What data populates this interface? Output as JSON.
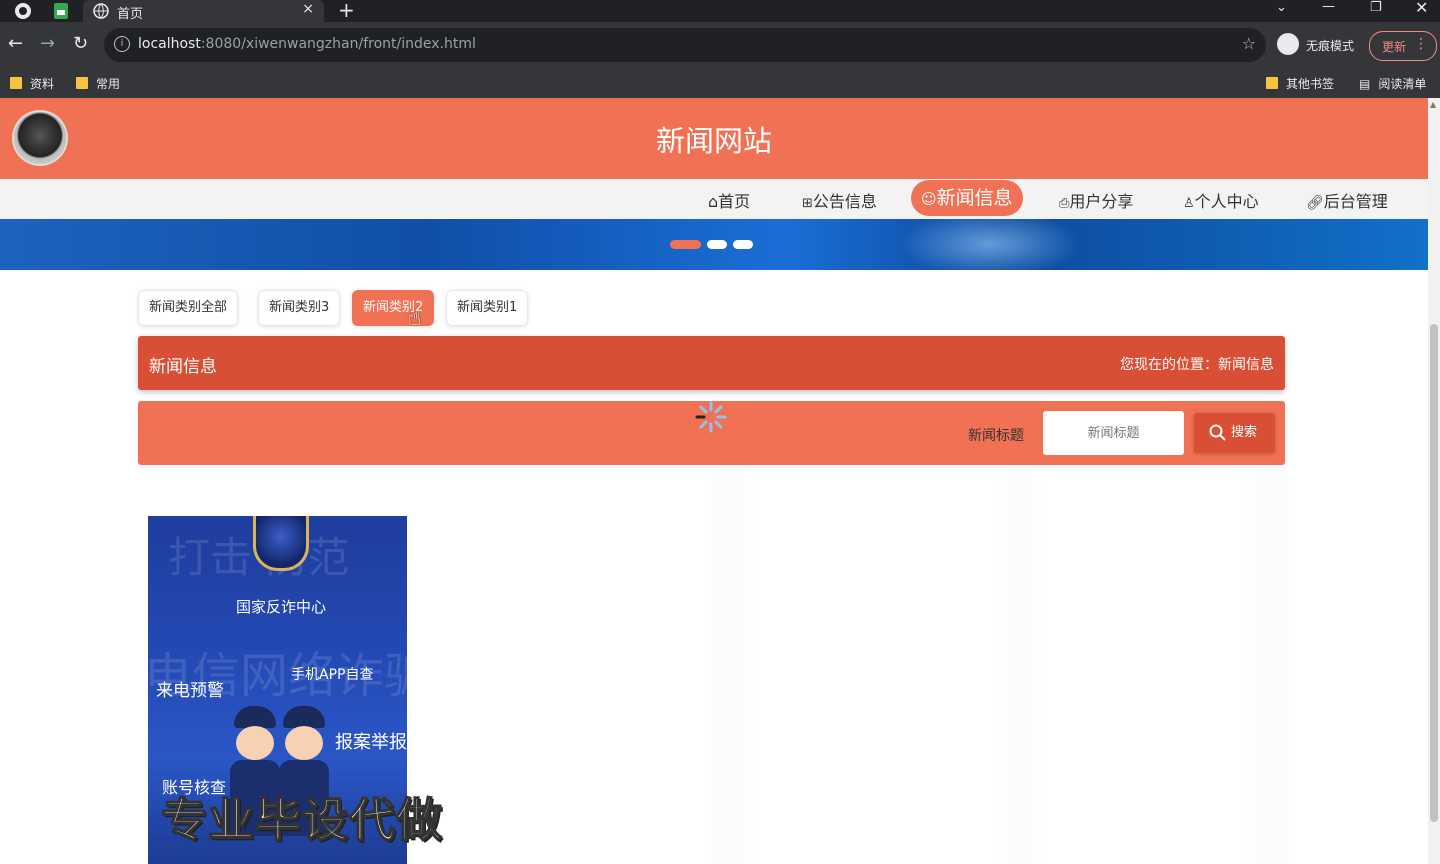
{
  "browser": {
    "tab_title": "首页",
    "tab_close": "×",
    "new_tab": "+",
    "url_host": "localhost",
    "url_rest": ":8080/xiwenwangzhan/front/index.html",
    "incognito_label": "无痕模式",
    "update_label": "更新",
    "bookmarks": [
      "资料",
      "常用"
    ],
    "other_bookmarks": "其他书签",
    "reading_list": "阅读清单"
  },
  "site": {
    "title": "新闻网站",
    "nav": [
      {
        "icon": "home-icon",
        "label": "首页"
      },
      {
        "icon": "gift-icon",
        "label": "公告信息"
      },
      {
        "icon": "smile-icon",
        "label": "新闻信息"
      },
      {
        "icon": "print-icon",
        "label": "用户分享"
      },
      {
        "icon": "user-icon",
        "label": "个人中心"
      },
      {
        "icon": "link-icon",
        "label": "后台管理"
      }
    ],
    "active_nav": "新闻信息"
  },
  "categories": [
    "新闻类别全部",
    "新闻类别3",
    "新闻类别2",
    "新闻类别1"
  ],
  "active_category": "新闻类别2",
  "section": {
    "title": "新闻信息",
    "breadcrumb": "您现在的位置：新闻信息"
  },
  "search": {
    "label": "新闻标题",
    "placeholder": "新闻标题",
    "button": "搜索"
  },
  "card": {
    "center": "国家反诈中心",
    "left_tag": "来电预警",
    "right_tag": "手机APP自查",
    "report_tag": "报案举报",
    "account_tag": "账号核查",
    "bg_line1": "打击 防范",
    "bg_line2": "电信网络诈骗"
  },
  "watermark": "专业毕设代做",
  "colors": {
    "primary": "#f07153",
    "dark": "#d84f36"
  }
}
